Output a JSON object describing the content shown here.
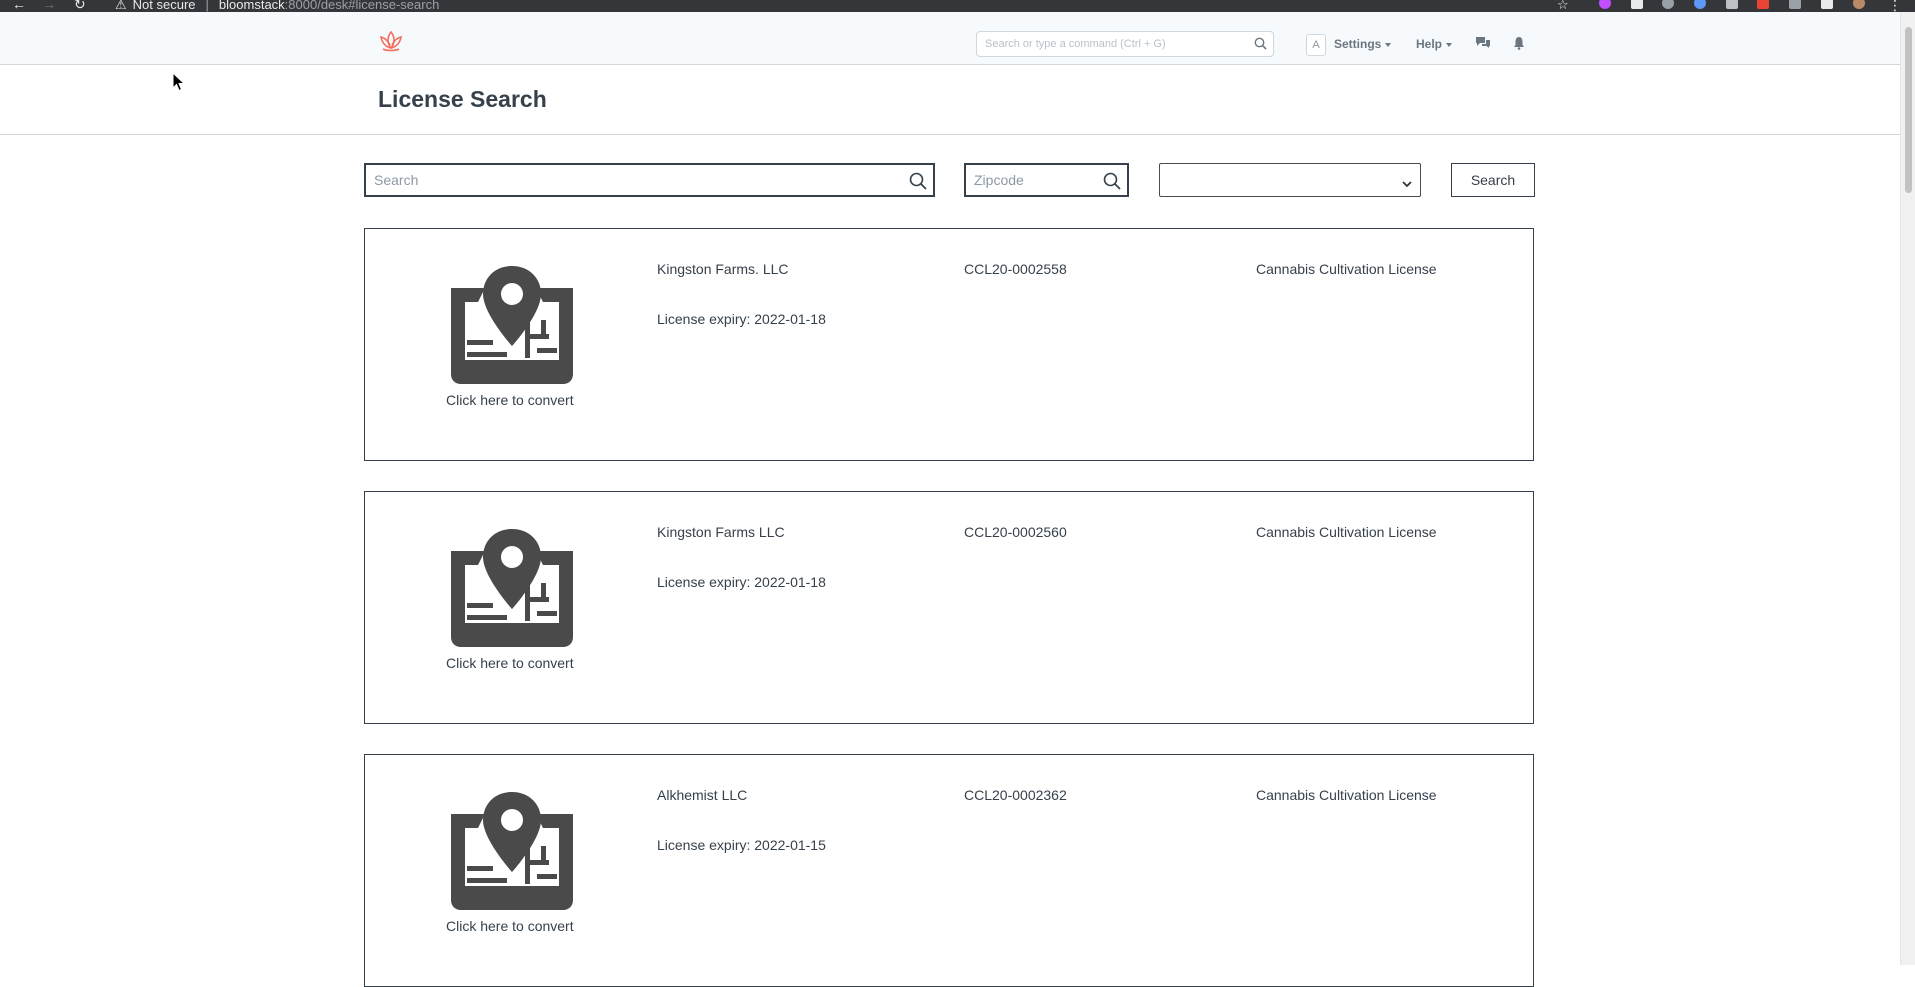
{
  "browser": {
    "security_label": "Not secure",
    "url_host": "bloomstack",
    "url_path": ":8000/desk#license-search"
  },
  "navbar": {
    "awesomebar_placeholder": "Search or type a command (Ctrl + G)",
    "avatar_letter": "A",
    "settings_label": "Settings",
    "help_label": "Help"
  },
  "page": {
    "title": "License Search"
  },
  "filters": {
    "search_placeholder": "Search",
    "zipcode_placeholder": "Zipcode",
    "select_value": "",
    "search_button_label": "Search"
  },
  "licenses": [
    {
      "company": "Kingston Farms. LLC",
      "license_number": "CCL20-0002558",
      "license_type": "Cannabis Cultivation License",
      "expiry": "License expiry: 2022-01-18",
      "convert_label": "Click here to convert"
    },
    {
      "company": "Kingston Farms LLC",
      "license_number": "CCL20-0002560",
      "license_type": "Cannabis Cultivation License",
      "expiry": "License expiry: 2022-01-18",
      "convert_label": "Click here to convert"
    },
    {
      "company": "Alkhemist LLC",
      "license_number": "CCL20-0002362",
      "license_type": "Cannabis Cultivation License",
      "expiry": "License expiry: 2022-01-15",
      "convert_label": "Click here to convert"
    }
  ],
  "colors": {
    "brand_logo": "#f36f5d",
    "text": "#36414c",
    "border": "#d1d8dd",
    "icon_fill": "#4a4a4a"
  },
  "icons": [
    "back-arrow-icon",
    "forward-arrow-icon",
    "reload-icon",
    "warning-icon",
    "star-icon",
    "lotus-logo-icon",
    "search-icon",
    "chat-icon",
    "bell-icon",
    "chevron-down-icon",
    "map-pin-icon"
  ]
}
